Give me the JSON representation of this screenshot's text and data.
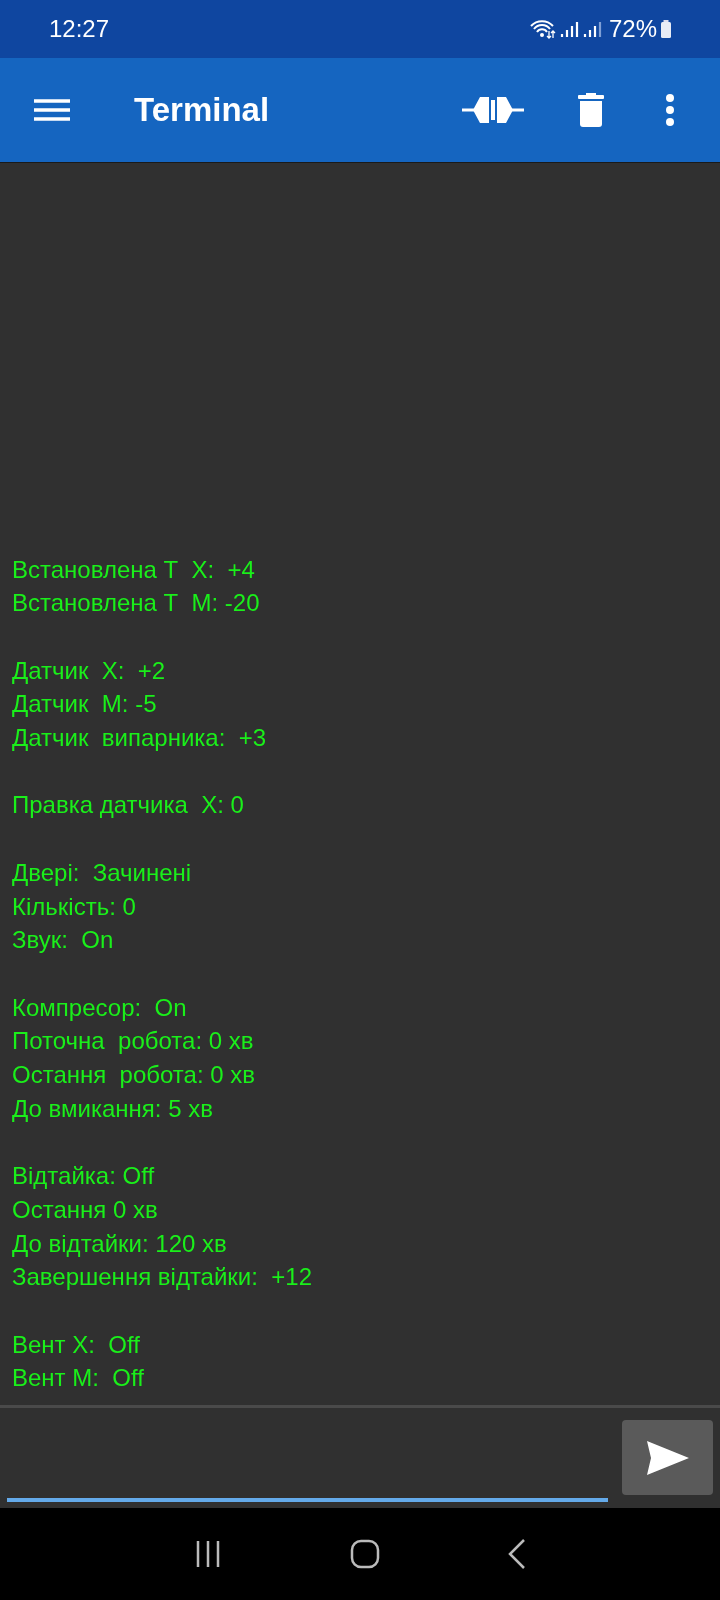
{
  "status_bar": {
    "time": "12:27",
    "battery": "72%"
  },
  "toolbar": {
    "title": "Terminal"
  },
  "terminal": {
    "groups": [
      {
        "lines": [
          "Встановлена Т  Х:  +4",
          "Встановлена Т  М: -20"
        ]
      },
      {
        "lines": [
          "Датчик  Х:  +2",
          "Датчик  М: -5",
          "Датчик  випарника:  +3"
        ]
      },
      {
        "lines": [
          "Правка датчика  Х: 0"
        ]
      },
      {
        "lines": [
          "Двері:  Зачинені",
          "Кількість: 0",
          "Звук:  On"
        ]
      },
      {
        "lines": [
          "Компресор:  On",
          "Поточна  робота: 0 хв",
          "Остання  робота: 0 хв",
          "До вмикання: 5 хв"
        ]
      },
      {
        "lines": [
          "Відтайка: Off",
          "Остання 0 хв",
          "До відтайки: 120 хв",
          "Завершення відтайки:  +12"
        ]
      },
      {
        "lines": [
          "Вент Х:  Off",
          "Вент М:  Off"
        ]
      }
    ]
  }
}
